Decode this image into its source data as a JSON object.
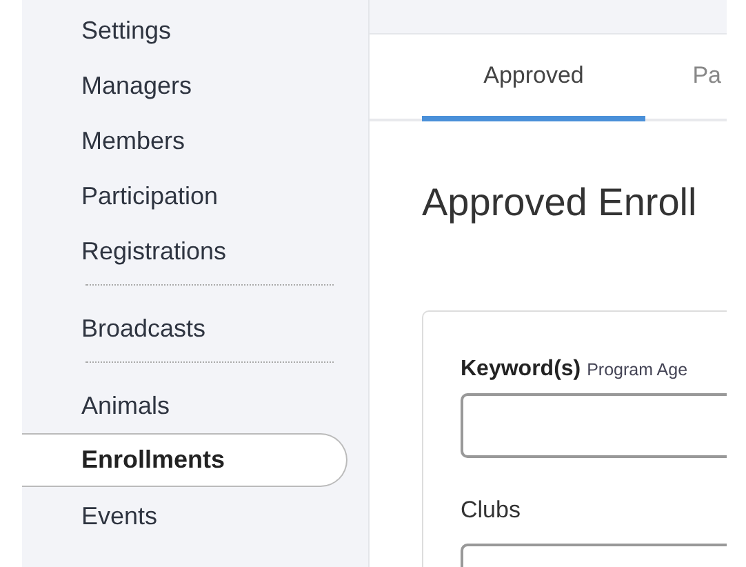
{
  "sidebar": {
    "groups": [
      {
        "items": [
          {
            "label": "Settings",
            "selected": false
          },
          {
            "label": "Managers",
            "selected": false
          },
          {
            "label": "Members",
            "selected": false
          },
          {
            "label": "Participation",
            "selected": false
          },
          {
            "label": "Registrations",
            "selected": false
          }
        ]
      },
      {
        "items": [
          {
            "label": "Broadcasts",
            "selected": false
          }
        ]
      },
      {
        "items": [
          {
            "label": "Animals",
            "selected": false
          },
          {
            "label": "Enrollments",
            "selected": true
          },
          {
            "label": "Events",
            "selected": false
          }
        ]
      }
    ]
  },
  "tabs": [
    {
      "label": "Approved",
      "selected": true
    },
    {
      "label": "Pa",
      "selected": false
    }
  ],
  "heading": "Approved Enroll",
  "filters": {
    "keyword": {
      "label": "Keyword(s)",
      "hint": "Program Age"
    },
    "clubs": {
      "label": "Clubs"
    }
  }
}
